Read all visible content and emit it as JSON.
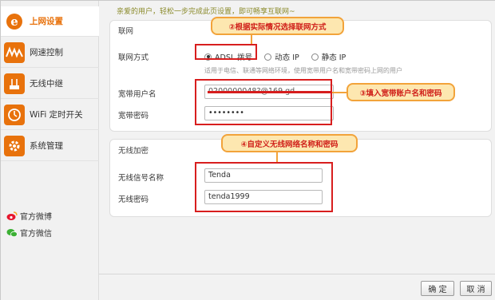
{
  "sidebar": {
    "items": [
      {
        "label": "上网设置",
        "icon": "ie-globe-icon",
        "active": true
      },
      {
        "label": "网速控制",
        "icon": "speed-wave-icon",
        "active": false
      },
      {
        "label": "无线中继",
        "icon": "wireless-repeater-icon",
        "active": false
      },
      {
        "label": "WiFi 定时开关",
        "icon": "wifi-timer-icon",
        "active": false
      },
      {
        "label": "系统管理",
        "icon": "gear-icon",
        "active": false
      }
    ],
    "social": [
      {
        "label": "官方微博",
        "icon": "weibo-icon"
      },
      {
        "label": "官方微信",
        "icon": "wechat-icon"
      }
    ]
  },
  "intro_text": "亲爱的用户，轻松一步完成此页设置，即可畅享互联网~",
  "wan": {
    "section_title": "联网",
    "mode_label": "联网方式",
    "modes": [
      {
        "label": "ADSL 拨号",
        "selected": true
      },
      {
        "label": "动态 IP",
        "selected": false
      },
      {
        "label": "静态 IP",
        "selected": false
      }
    ],
    "hint": "适用于电信、联通等网络环境，使用宽带用户名和宽带密码上网的用户",
    "username_label": "宽带用户名",
    "username_value": "0200000048?@169.gd",
    "password_label": "宽带密码",
    "password_value": "••••••••"
  },
  "wireless": {
    "section_title": "无线加密",
    "ssid_label": "无线信号名称",
    "ssid_value": "Tenda",
    "password_label": "无线密码",
    "password_value": "tenda1999"
  },
  "callouts": {
    "step2": "②根据实际情况选择联网方式",
    "step3": "③填入宽带账户名和密码",
    "step4": "④自定义无线网络名称和密码"
  },
  "buttons": {
    "confirm": "确 定",
    "cancel": "取 消"
  },
  "colors": {
    "accent_orange": "#e8720c",
    "annotation_red": "#d81e1e",
    "callout_fill": "#fde7b0",
    "callout_border": "#f2a33a"
  }
}
